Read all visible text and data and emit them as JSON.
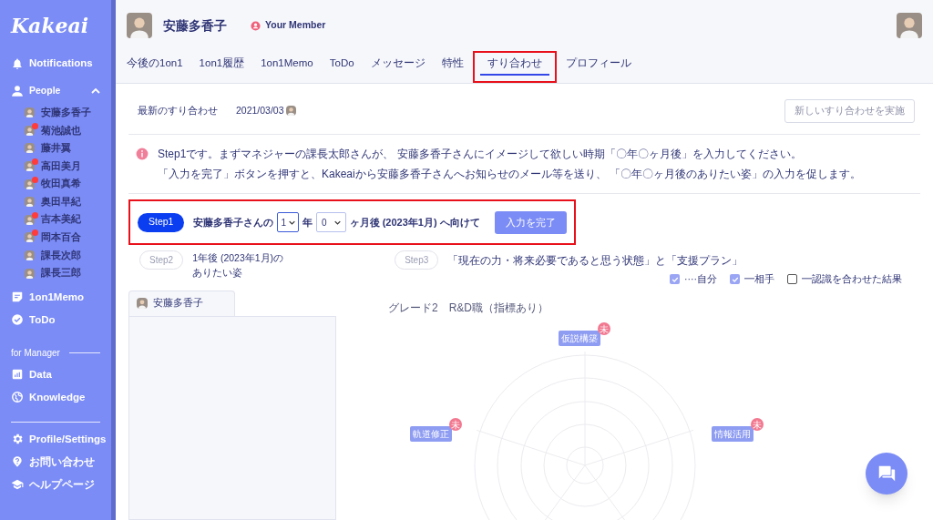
{
  "sidebar": {
    "logo": "Kakeai",
    "nav": [
      {
        "label": "Notifications"
      }
    ],
    "people": {
      "label": "People",
      "expanded": true,
      "items": [
        {
          "name": "安藤多香子",
          "unread": false
        },
        {
          "name": "菊池誠也",
          "unread": true
        },
        {
          "name": "藤井翼",
          "unread": false
        },
        {
          "name": "高田美月",
          "unread": true
        },
        {
          "name": "牧田真希",
          "unread": true
        },
        {
          "name": "奥田早紀",
          "unread": false
        },
        {
          "name": "吉本美紀",
          "unread": true
        },
        {
          "name": "岡本百合",
          "unread": true
        },
        {
          "name": "課長次郎",
          "unread": false
        },
        {
          "name": "課長三郎",
          "unread": false
        }
      ]
    },
    "nav2": [
      {
        "label": "1on1Memo"
      },
      {
        "label": "ToDo"
      }
    ],
    "section_label": "for Manager",
    "manager_nav": [
      {
        "label": "Data"
      },
      {
        "label": "Knowledge"
      }
    ],
    "footer_nav": [
      {
        "label": "Profile/Settings"
      },
      {
        "label": "お問い合わせ"
      },
      {
        "label": "ヘルプページ"
      }
    ]
  },
  "header": {
    "name": "安藤多香子",
    "role": "Your Member"
  },
  "tabs": [
    {
      "label": "今後の1on1",
      "selected": false
    },
    {
      "label": "1on1履歴",
      "selected": false
    },
    {
      "label": "1on1Memo",
      "selected": false
    },
    {
      "label": "ToDo",
      "selected": false
    },
    {
      "label": "メッセージ",
      "selected": false
    },
    {
      "label": "特性",
      "selected": false
    },
    {
      "label": "すり合わせ",
      "selected": true
    },
    {
      "label": "プロフィール",
      "selected": false
    }
  ],
  "latest": {
    "label": "最新のすり合わせ",
    "date": "2021/03/03",
    "button": "新しいすり合わせを実施"
  },
  "info": [
    "Step1です。まずマネジャーの課長太郎さんが、 安藤多香子さんにイメージして欲しい時期「〇年〇ヶ月後」を入力してください。",
    "「入力を完了」ボタンを押すと、Kakeaiから安藤多香子さんへお知らせのメール等を送り、 「〇年〇ヶ月後のありたい姿」の入力を促します。"
  ],
  "step1": {
    "badge": "Step1",
    "prefix": "安藤多香子さんの",
    "years": "1",
    "year_unit": "年",
    "months": "0",
    "suffix": "ヶ月後 (2023年1月) へ向けて",
    "button": "入力を完了"
  },
  "step2": {
    "badge": "Step2",
    "lines": [
      "1年後 (2023年1月)の",
      "ありたい姿"
    ]
  },
  "step3": {
    "badge": "Step3",
    "text": "「現在の力・将来必要であると思う状態」と「支援プラン」"
  },
  "legend": [
    {
      "label": "····自分",
      "checked": true
    },
    {
      "label": "━相手",
      "checked": true
    },
    {
      "label": "━認識を合わせた結果",
      "checked": false
    }
  ],
  "card_tab": {
    "name": "安藤多香子"
  },
  "chart": {
    "title": "グレード2　R&D職（指標あり）",
    "axes": [
      {
        "label": "仮説構築",
        "badge": "未"
      },
      {
        "label": "軌道修正",
        "badge": "未"
      },
      {
        "label": "情報活用",
        "badge": "未"
      }
    ]
  }
}
